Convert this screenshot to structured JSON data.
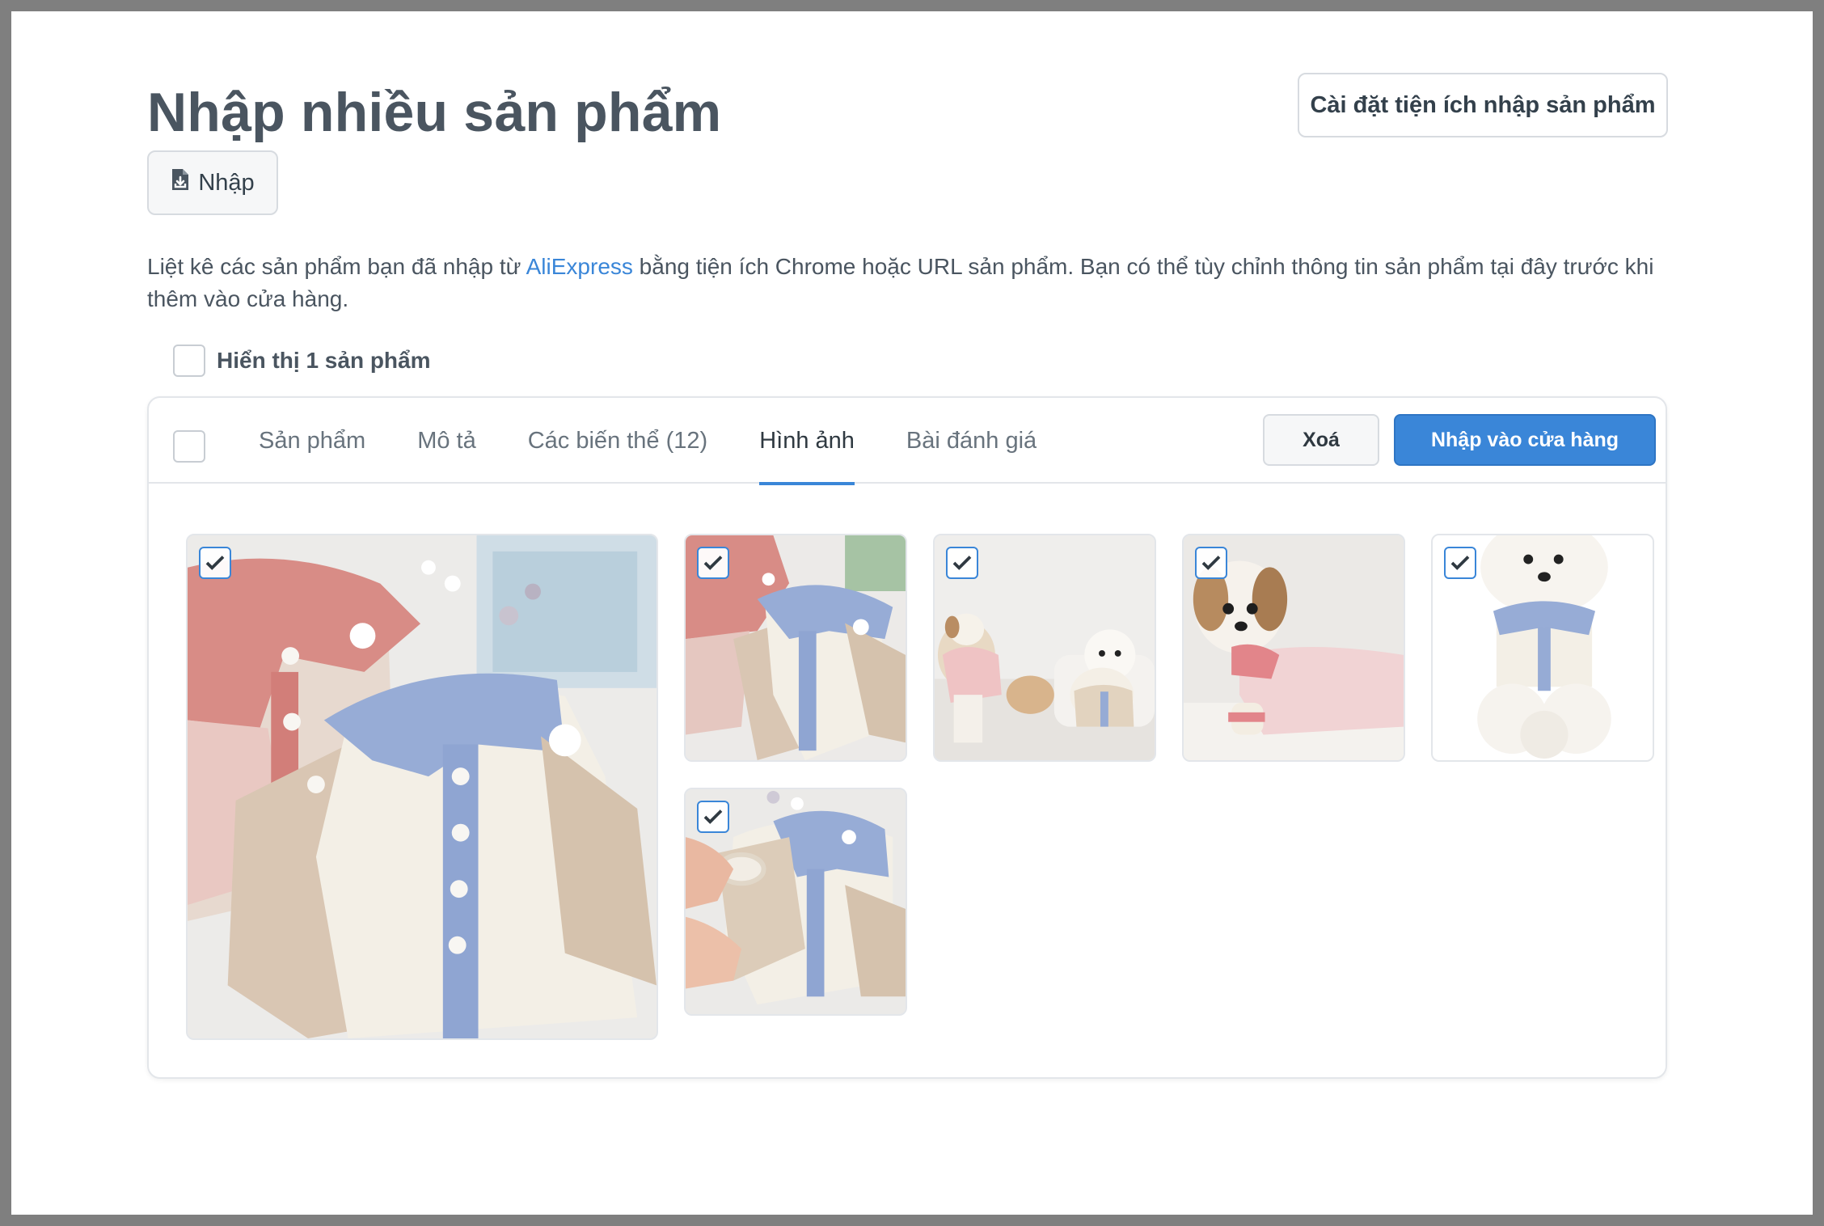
{
  "page": {
    "title": "Nhập nhiều sản phẩm",
    "settings_button": "Cài đặt tiện ích nhập sản phẩm",
    "import_button": "Nhập",
    "description_before": "Liệt kê các sản phẩm bạn đã nhập từ ",
    "description_link": "AliExpress",
    "description_after": " bằng tiện ích Chrome hoặc URL sản phẩm. Bạn có thể tùy chỉnh thông tin sản phẩm tại đây trước khi thêm vào cửa hàng.",
    "show_count_label": "Hiển thị 1 sản phẩm"
  },
  "panel": {
    "tabs": [
      {
        "label": "Sản phẩm",
        "active": false
      },
      {
        "label": "Mô tả",
        "active": false
      },
      {
        "label": "Các biến thể (12)",
        "active": false
      },
      {
        "label": "Hình ảnh",
        "active": true
      },
      {
        "label": "Bài đánh giá",
        "active": false
      }
    ],
    "delete_button": "Xoá",
    "import_store_button": "Nhập vào cửa hàng",
    "images": [
      {
        "name": "sweaters-flatlay-main",
        "checked": true
      },
      {
        "name": "sweaters-flatlay-small",
        "checked": true
      },
      {
        "name": "two-dogs-wearing",
        "checked": true
      },
      {
        "name": "shihtzu-pink-sweater",
        "checked": true
      },
      {
        "name": "bichon-blue-collar",
        "checked": true
      },
      {
        "name": "hands-fitting-sweater",
        "checked": true
      }
    ]
  },
  "colors": {
    "accent": "#3a86d8",
    "title": "#4a5560",
    "pink": "#e49a94",
    "blue": "#93a9d4",
    "beige": "#d9c8b6",
    "cream": "#f3efe7"
  }
}
